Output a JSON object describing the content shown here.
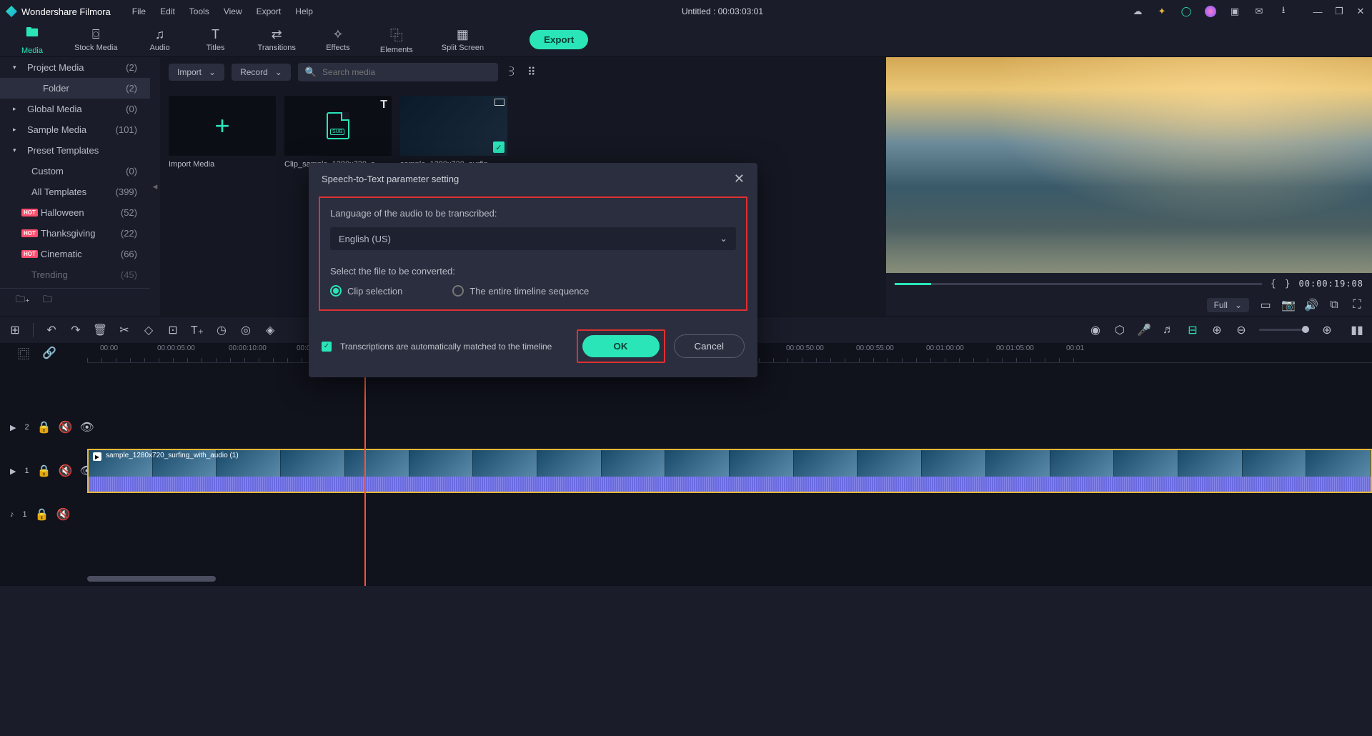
{
  "app": {
    "name": "Wondershare Filmora",
    "doc_title": "Untitled : 00:03:03:01"
  },
  "menu": [
    "File",
    "Edit",
    "Tools",
    "View",
    "Export",
    "Help"
  ],
  "top_tabs": [
    {
      "label": "Media",
      "active": true
    },
    {
      "label": "Stock Media"
    },
    {
      "label": "Audio"
    },
    {
      "label": "Titles"
    },
    {
      "label": "Transitions"
    },
    {
      "label": "Effects"
    },
    {
      "label": "Elements"
    },
    {
      "label": "Split Screen"
    }
  ],
  "export_label": "Export",
  "sidebar": {
    "items": [
      {
        "label": "Project Media",
        "count": "(2)",
        "chev": "▾",
        "header": true
      },
      {
        "label": "Folder",
        "count": "(2)",
        "selected": true
      },
      {
        "label": "Global Media",
        "count": "(0)",
        "chev": "▸",
        "header": true
      },
      {
        "label": "Sample Media",
        "count": "(101)",
        "chev": "▸",
        "header": true
      },
      {
        "label": "Preset Templates",
        "count": "",
        "chev": "▾",
        "header": true
      },
      {
        "label": "Custom",
        "count": "(0)"
      },
      {
        "label": "All Templates",
        "count": "(399)"
      },
      {
        "label": "Halloween",
        "count": "(52)",
        "hot": true
      },
      {
        "label": "Thanksgiving",
        "count": "(22)",
        "hot": true
      },
      {
        "label": "Cinematic",
        "count": "(66)",
        "hot": true
      },
      {
        "label": "Trending",
        "count": "(45)",
        "fade": true
      }
    ]
  },
  "media_toolbar": {
    "import": "Import",
    "record": "Record",
    "search_placeholder": "Search media"
  },
  "media_items": [
    {
      "label": "Import Media",
      "kind": "import"
    },
    {
      "label": "Clip_sample_1280x720_s...",
      "kind": "subtitle"
    },
    {
      "label": "sample_1280x720_surfin...",
      "kind": "video"
    }
  ],
  "preview": {
    "timecode": "00:00:19:08",
    "quality": "Full",
    "markers": {
      "in": "{",
      "out": "}"
    }
  },
  "ruler": [
    "00:00",
    "00:00:05:00",
    "00:00:10:00",
    "00:00:15:00",
    "00:00:50:00",
    "00:00:55:00",
    "00:01:00:00",
    "00:01:05:00",
    "00:01"
  ],
  "ruler_pos": [
    140,
    220,
    320,
    415,
    1100,
    1198,
    1296,
    1394,
    1492
  ],
  "tracks": {
    "v2": "2",
    "v1": "1",
    "a1": "1",
    "clip_label": "sample_1280x720_surfing_with_audio (1)"
  },
  "dialog": {
    "title": "Speech-to-Text parameter setting",
    "lang_label": "Language of the audio to be transcribed:",
    "lang_value": "English (US)",
    "select_label": "Select the file to be converted:",
    "opt_clip": "Clip selection",
    "opt_timeline": "The entire timeline sequence",
    "auto_match": "Transcriptions are automatically matched to the timeline",
    "ok": "OK",
    "cancel": "Cancel"
  },
  "hot_label": "HOT"
}
